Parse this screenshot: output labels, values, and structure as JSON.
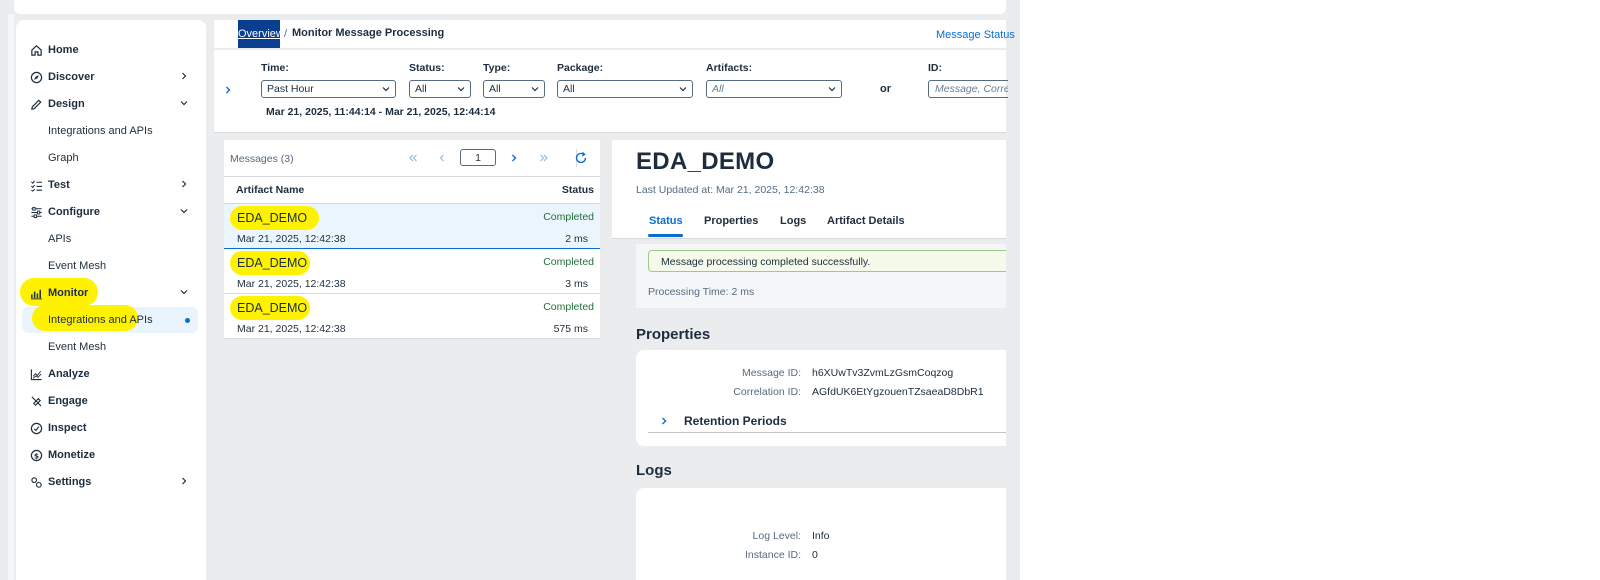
{
  "sidebar": {
    "items": [
      {
        "label": "Home"
      },
      {
        "label": "Discover"
      },
      {
        "label": "Design"
      },
      {
        "label": "Integrations and APIs"
      },
      {
        "label": "Graph"
      },
      {
        "label": "Test"
      },
      {
        "label": "Configure"
      },
      {
        "label": "APIs"
      },
      {
        "label": "Event Mesh"
      },
      {
        "label": "Monitor"
      },
      {
        "label": "Integrations and APIs"
      },
      {
        "label": "Event Mesh"
      },
      {
        "label": "Analyze"
      },
      {
        "label": "Engage"
      },
      {
        "label": "Inspect"
      },
      {
        "label": "Monetize"
      },
      {
        "label": "Settings"
      }
    ]
  },
  "header": {
    "breadcrumb_link": "Overview",
    "breadcrumb_sep": "/",
    "title": "Monitor Message Processing",
    "status_link": "Message Status"
  },
  "filters": {
    "time": {
      "label": "Time:",
      "value": "Past Hour"
    },
    "status": {
      "label": "Status:",
      "value": "All"
    },
    "type": {
      "label": "Type:",
      "value": "All"
    },
    "package": {
      "label": "Package:",
      "value": "All"
    },
    "artifacts": {
      "label": "Artifacts:",
      "value": "All"
    },
    "or": "or",
    "id": {
      "label": "ID:",
      "placeholder": "Message, Corre"
    },
    "range": "Mar 21, 2025, 11:44:14 - Mar 21, 2025, 12:44:14"
  },
  "list": {
    "count": "Messages (3)",
    "page": "1",
    "col_name": "Artifact Name",
    "col_status": "Status",
    "rows": [
      {
        "name": "EDA_DEMO",
        "status": "Completed",
        "date": "Mar 21, 2025, 12:42:38",
        "duration": "2 ms"
      },
      {
        "name": "EDA_DEMO",
        "status": "Completed",
        "date": "Mar 21, 2025, 12:42:38",
        "duration": "3 ms"
      },
      {
        "name": "EDA_DEMO",
        "status": "Completed",
        "date": "Mar 21, 2025, 12:42:38",
        "duration": "575 ms"
      }
    ]
  },
  "detail": {
    "title": "EDA_DEMO",
    "updated": "Last Updated at: Mar 21, 2025, 12:42:38",
    "tabs": [
      "Status",
      "Properties",
      "Logs",
      "Artifact Details"
    ],
    "success_message": "Message processing completed successfully.",
    "processing_time": "Processing Time: 2 ms",
    "properties_title": "Properties",
    "message_id_label": "Message ID:",
    "message_id": "h6XUwTv3ZvmLzGsmCoqzog",
    "correlation_id_label": "Correlation ID:",
    "correlation_id": "AGfdUK6EtYgzouenTZsaeaD8DbR1",
    "retention_label": "Retention Periods",
    "logs_title": "Logs",
    "log_level_label": "Log Level:",
    "log_level": "Info",
    "instance_id_label": "Instance ID:",
    "instance_id": "0"
  },
  "colors": {
    "accent": "#0a6ed1",
    "highlight": "#fff200",
    "success": "#256f3a"
  }
}
